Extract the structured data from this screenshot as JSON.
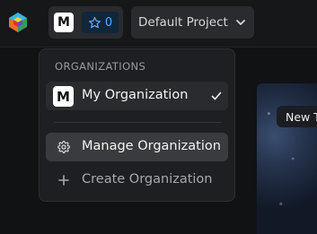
{
  "topbar": {
    "org_avatar_letter": "M",
    "stars_count": "0",
    "project_label": "Default Project"
  },
  "dropdown": {
    "heading": "ORGANIZATIONS",
    "current_org": {
      "avatar_letter": "M",
      "label": "My Organization"
    },
    "manage_label": "Manage Organization",
    "create_label": "Create Organization"
  },
  "background": {
    "tag_label": "New T"
  },
  "colors": {
    "accent_blue": "#5aa8ff",
    "menu_bg": "#1e1f22",
    "hover_bg": "#3a3b3f"
  },
  "icons": [
    "app-logo-icon",
    "star-icon",
    "chevron-down-icon",
    "check-icon",
    "gear-icon",
    "plus-icon"
  ]
}
